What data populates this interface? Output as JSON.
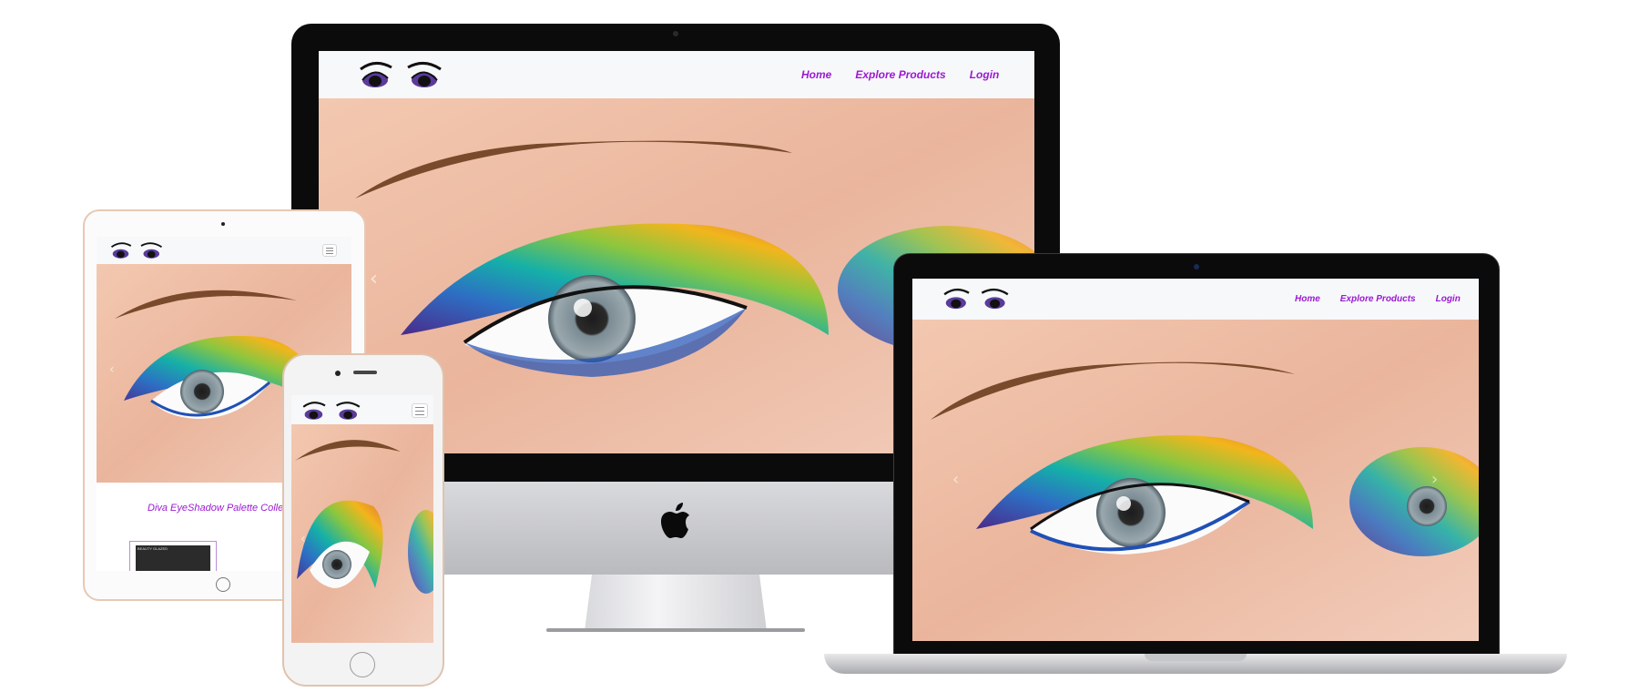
{
  "site": {
    "nav": {
      "home_label": "Home",
      "explore_label": "Explore Products",
      "login_label": "Login"
    },
    "carousel": {
      "prev_glyph": "‹",
      "next_glyph": "›"
    },
    "tablet_section": {
      "title": "Diva EyeShadow Palette Collection",
      "product_label": "BEAUTY GLAZED"
    }
  },
  "icons": {
    "brand_logo": "eyes-logo",
    "menu": "hamburger-icon",
    "apple": "apple-logo"
  },
  "colors": {
    "accent": "#9b1ad2",
    "navbar_bg": "#f7f8fa",
    "bezel": "#0b0b0b",
    "stand": "#c7c8cc"
  }
}
